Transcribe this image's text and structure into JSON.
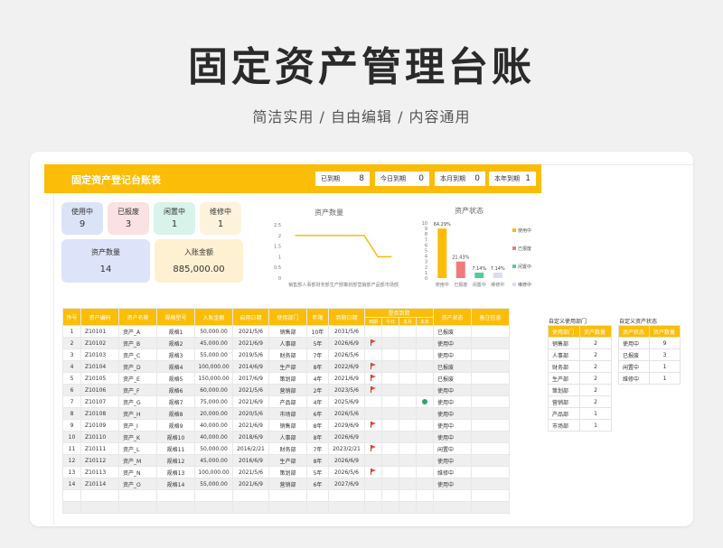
{
  "hero": {
    "title": "固定资产管理台账",
    "subtitle": "简洁实用 / 自由编辑 / 内容通用"
  },
  "sheet": {
    "title": "固定资产登记台账表",
    "counters": [
      {
        "label": "已到期",
        "value": "8"
      },
      {
        "label": "今日到期",
        "value": "0"
      },
      {
        "label": "本月到期",
        "value": "0"
      },
      {
        "label": "本年到期",
        "value": "1"
      }
    ],
    "tiles": [
      {
        "label": "使用中",
        "value": "9",
        "color": "#dbe4f7"
      },
      {
        "label": "已报废",
        "value": "3",
        "color": "#fbe1e1"
      },
      {
        "label": "闲置中",
        "value": "1",
        "color": "#d7f3ea"
      },
      {
        "label": "维修中",
        "value": "1",
        "color": "#fdf3dc"
      }
    ],
    "total_count": {
      "label": "资产数量",
      "value": "14",
      "color": "#dde3f9"
    },
    "total_amount": {
      "label": "入账金额",
      "value": "885,000.00",
      "color": "#fdf1d2"
    }
  },
  "colors": {
    "accent": "#fbbd07",
    "line": "#fbbd07"
  },
  "chart_data": [
    {
      "type": "line",
      "title": "资产数量",
      "categories": [
        "销售部",
        "人事部",
        "财务部",
        "生产部",
        "策划部",
        "营销部",
        "产品部",
        "市场部"
      ],
      "values": [
        2,
        2,
        2,
        2,
        2,
        2,
        1,
        1
      ],
      "ylim": [
        0,
        2.5
      ],
      "yticks": [
        "0",
        "0.5",
        "1",
        "1.5",
        "2",
        "2.5"
      ],
      "grid": false
    },
    {
      "type": "bar",
      "title": "资产状态",
      "categories": [
        "使用中",
        "已报废",
        "闲置中",
        "维修中"
      ],
      "values": [
        64.29,
        21.43,
        7.14,
        7.14
      ],
      "data_labels": [
        "64.29%",
        "21.43%",
        "7.14%",
        "7.14%"
      ],
      "colors": [
        "#fbbd07",
        "#f07b7b",
        "#4dcf9a",
        "#d9dcf5"
      ],
      "ylim": [
        0,
        10
      ],
      "yticks": [
        "0",
        "1",
        "2",
        "3",
        "4",
        "5",
        "6",
        "7",
        "8",
        "9",
        "10"
      ],
      "legend": "right",
      "legend_entries": [
        "使用中",
        "已报废",
        "闲置中",
        "维修中"
      ]
    }
  ],
  "table": {
    "headers": [
      "序号",
      "资产编码",
      "资产名称",
      "规格型号",
      "入账金额",
      "启用日期",
      "使用部门",
      "年限",
      "到期日期",
      "是否到期",
      "资产状态",
      "备注信息"
    ],
    "sub_headers": [
      "到期",
      "今日",
      "本月",
      "本年"
    ],
    "rows": [
      [
        "1",
        "Z10101",
        "资产_A",
        "规格1",
        "50,000.00",
        "2021/5/6",
        "销售部",
        "10年",
        "2031/5/6",
        "",
        "",
        "",
        "",
        "已报废",
        ""
      ],
      [
        "2",
        "Z10102",
        "资产_B",
        "规格2",
        "45,000.00",
        "2021/6/9",
        "人事部",
        "5年",
        "2026/6/9",
        "flag",
        "",
        "",
        "",
        "使用中",
        ""
      ],
      [
        "3",
        "Z10103",
        "资产_C",
        "规格3",
        "55,000.00",
        "2019/5/6",
        "财务部",
        "7年",
        "2026/5/6",
        "",
        "",
        "",
        "",
        "使用中",
        ""
      ],
      [
        "4",
        "Z10104",
        "资产_D",
        "规格4",
        "100,000.00",
        "2014/6/9",
        "生产部",
        "8年",
        "2022/6/9",
        "flag",
        "",
        "",
        "",
        "已报废",
        ""
      ],
      [
        "5",
        "Z10105",
        "资产_E",
        "规格5",
        "150,000.00",
        "2017/6/9",
        "策划部",
        "4年",
        "2021/6/9",
        "flag",
        "",
        "",
        "",
        "已报废",
        ""
      ],
      [
        "6",
        "Z10106",
        "资产_F",
        "规格6",
        "60,000.00",
        "2021/5/6",
        "营销部",
        "2年",
        "2023/5/6",
        "flag",
        "",
        "",
        "",
        "使用中",
        ""
      ],
      [
        "7",
        "Z10107",
        "资产_G",
        "规格7",
        "75,000.00",
        "2021/6/9",
        "产品部",
        "4年",
        "2025/6/9",
        "",
        "",
        "",
        "dot",
        "使用中",
        ""
      ],
      [
        "8",
        "Z10108",
        "资产_H",
        "规格8",
        "20,000.00",
        "2020/5/6",
        "市场部",
        "6年",
        "2026/5/6",
        "",
        "",
        "",
        "",
        "使用中",
        ""
      ],
      [
        "9",
        "Z10109",
        "资产_I",
        "规格9",
        "40,000.00",
        "2021/6/9",
        "销售部",
        "8年",
        "2029/6/9",
        "flag",
        "",
        "",
        "",
        "使用中",
        ""
      ],
      [
        "10",
        "Z10110",
        "资产_K",
        "规格10",
        "40,000.00",
        "2018/6/9",
        "人事部",
        "8年",
        "2026/6/9",
        "",
        "",
        "",
        "",
        "使用中",
        ""
      ],
      [
        "11",
        "Z10111",
        "资产_L",
        "规格11",
        "50,000.00",
        "2016/2/21",
        "财务部",
        "7年",
        "2023/2/21",
        "flag",
        "",
        "",
        "",
        "闲置中",
        ""
      ],
      [
        "12",
        "Z10112",
        "资产_M",
        "规格12",
        "45,000.00",
        "2016/6/9",
        "生产部",
        "8年",
        "2026/6/9",
        "",
        "",
        "",
        "",
        "使用中",
        ""
      ],
      [
        "13",
        "Z10113",
        "资产_N",
        "规格13",
        "100,000.00",
        "2021/5/6",
        "策划部",
        "5年",
        "2026/5/6",
        "flag",
        "",
        "",
        "",
        "维修中",
        ""
      ],
      [
        "14",
        "Z10114",
        "资产_O",
        "规格14",
        "55,000.00",
        "2021/6/9",
        "营销部",
        "6年",
        "2027/6/9",
        "",
        "",
        "",
        "",
        "使用中",
        ""
      ]
    ]
  },
  "dept_table": {
    "caption": "自定义使用部门",
    "headers": [
      "使用部门",
      "资产数量"
    ],
    "rows": [
      [
        "销售部",
        "2"
      ],
      [
        "人事部",
        "2"
      ],
      [
        "财务部",
        "2"
      ],
      [
        "生产部",
        "2"
      ],
      [
        "策划部",
        "2"
      ],
      [
        "营销部",
        "2"
      ],
      [
        "产品部",
        "1"
      ],
      [
        "市场部",
        "1"
      ]
    ]
  },
  "status_table": {
    "caption": "自定义资产状态",
    "headers": [
      "资产状态",
      "资产数量"
    ],
    "rows": [
      [
        "使用中",
        "9"
      ],
      [
        "已报废",
        "3"
      ],
      [
        "闲置中",
        "1"
      ],
      [
        "维修中",
        "1"
      ]
    ]
  }
}
